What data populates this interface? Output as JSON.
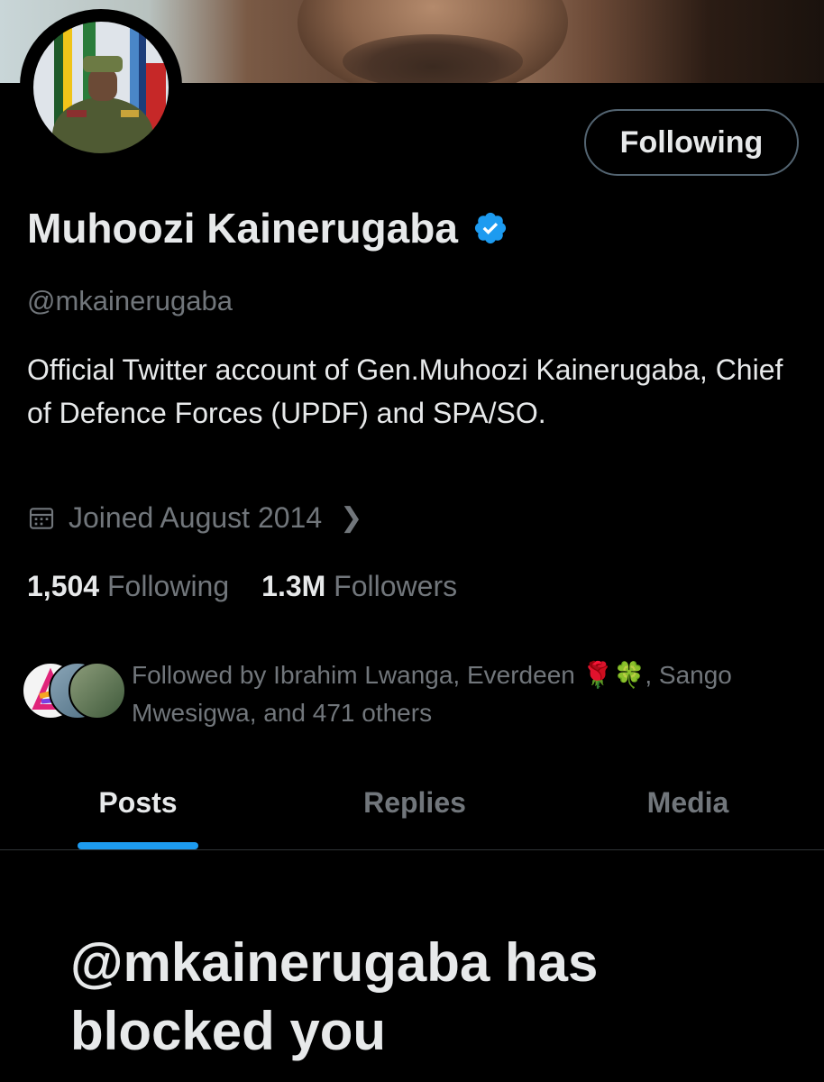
{
  "profile": {
    "name": "Muhoozi Kainerugaba",
    "handle": "@mkainerugaba",
    "bio": "Official Twitter account of Gen.Muhoozi Kainerugaba, Chief of Defence Forces (UPDF) and SPA/SO.",
    "joined": "Joined August 2014",
    "follow_button_label": "Following",
    "verified_icon": "verified-badge-icon",
    "accent_color": "#1d9bf0"
  },
  "stats": {
    "following_count": "1,504",
    "following_label": "Following",
    "followers_count": "1.3M",
    "followers_label": "Followers"
  },
  "followed_by": {
    "text": "Followed by Ibrahim Lwanga, Everdeen 🌹🍀, Sango Mwesigwa, and 471 others"
  },
  "tabs": [
    {
      "label": "Posts",
      "active": true
    },
    {
      "label": "Replies",
      "active": false
    },
    {
      "label": "Media",
      "active": false
    }
  ],
  "blocked_message": "@mkainerugaba has blocked you"
}
